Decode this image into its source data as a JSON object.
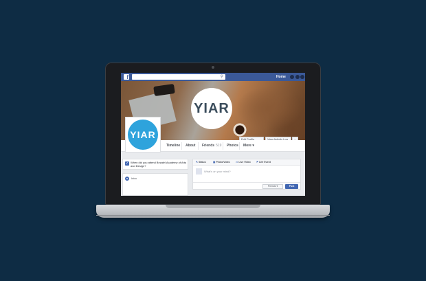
{
  "topbar": {
    "logo_glyph": "f",
    "search_icon": "search-icon",
    "home_label": "Home"
  },
  "cover": {
    "logo_text": "YIAR",
    "edit_profile_label": "Edit Profile",
    "url_label": "View Activity Log",
    "more_label": "···"
  },
  "profile": {
    "logo_text": "YIAR"
  },
  "nav": {
    "items": [
      {
        "label": "Timeline"
      },
      {
        "label": "About"
      },
      {
        "label": "Friends",
        "count": "519"
      },
      {
        "label": "Photos"
      },
      {
        "label": "More ▾"
      }
    ]
  },
  "prompt_card": {
    "text": "When did you attend Bezalel Academy of Arts and Design?",
    "close": "×"
  },
  "intro_card": {
    "label": "Intro"
  },
  "composer": {
    "tabs": [
      {
        "label": "Status"
      },
      {
        "label": "Photo/Video"
      },
      {
        "label": "Live Video"
      },
      {
        "label": "Life Event"
      }
    ],
    "placeholder": "What's on your mind?",
    "audience_label": "Friends ▾",
    "post_label": "Post"
  },
  "colors": {
    "background": "#0e2c44",
    "facebook_blue": "#3b5998",
    "profile_circle": "#2ea3dc"
  }
}
